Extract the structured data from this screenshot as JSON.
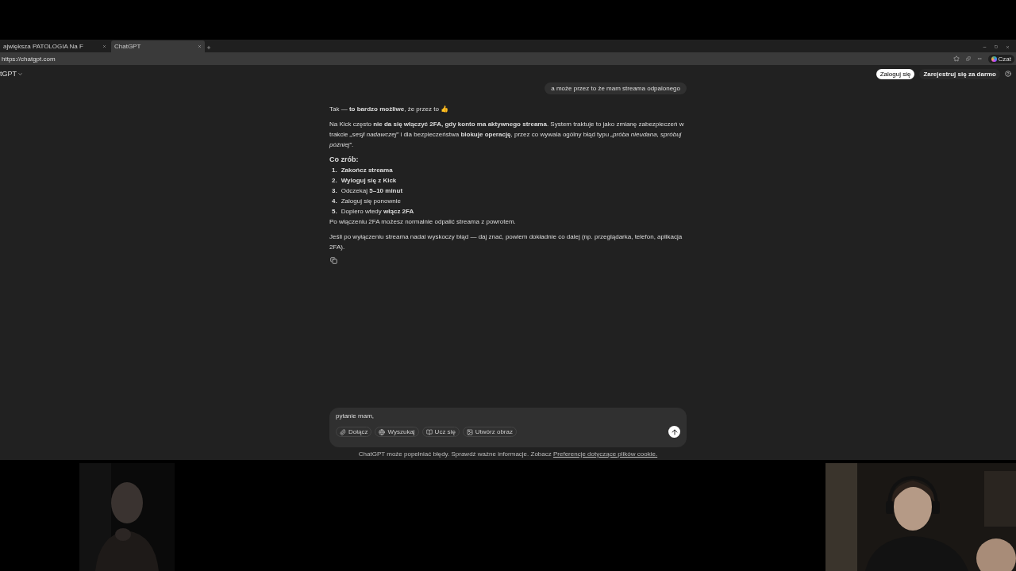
{
  "browser": {
    "tabs": [
      {
        "title": "ajwiększa PATOLOGIA Na F",
        "selected": false
      },
      {
        "title": "ChatGPT",
        "selected": true
      }
    ],
    "url": "https://chatgpt.com",
    "profile_label": "Czat"
  },
  "header": {
    "model": "tGPT",
    "login": "Zaloguj się",
    "signup": "Zarejestruj się za darmo"
  },
  "conversation": {
    "user_message": "a może przez to że mam streama odpalonego",
    "answer": {
      "intro": "Tak — **to bardzo możliwe**, że przez to 👍",
      "paragraph": "Na Kick często **nie da się włączyć 2FA, gdy konto ma aktywnego streama**. System traktuje to jako zmianę zabezpieczeń w trakcie *„sesji nadawczej”* i dla bezpieczeństwa **blokuje operację**, przez co wywala ogólny błąd typu *„próba nieudana, spróbuj później”*.",
      "heading": "Co zrób:",
      "steps": [
        {
          "number": "1.",
          "text": "**Zakończ streama**"
        },
        {
          "number": "2.",
          "text": "**Wyloguj się z Kick**"
        },
        {
          "number": "3.",
          "text": "Odczekaj **5–10 minut**"
        },
        {
          "number": "4.",
          "text": "Zaloguj się ponownie"
        },
        {
          "number": "5.",
          "text": "Dopiero wtedy **włącz 2FA**"
        }
      ],
      "after": "Po włączeniu 2FA możesz normalnie odpalić streama z powrotem.",
      "closing": "Jeśli po wyłączeniu streama nadal wyskoczy błąd — daj znać, powiem dokładnie co dalej (np. przeglądarka, telefon, aplikacja 2FA)."
    }
  },
  "composer": {
    "value": "pytanie mam,",
    "tools": [
      "Dołącz",
      "Wyszukaj",
      "Ucz się",
      "Utwórz obraz"
    ]
  },
  "footer": {
    "text": "ChatGPT może popełniać błędy. Sprawdź ważne informacje. Zobacz",
    "link": "Preferencje dotyczące plików cookie."
  }
}
